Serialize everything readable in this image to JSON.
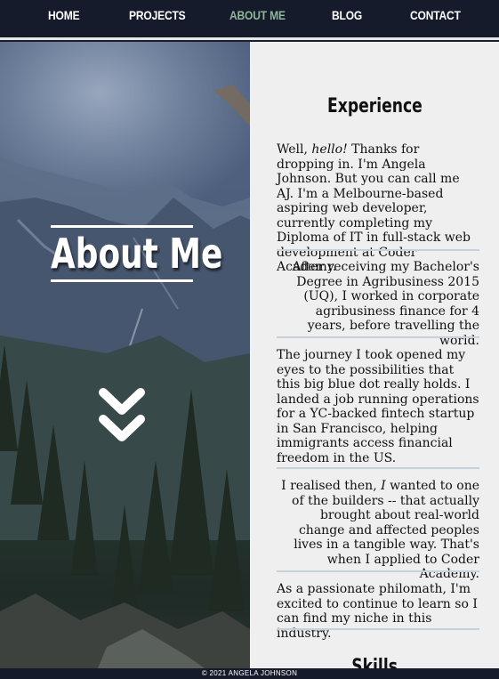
{
  "nav": {
    "items": [
      {
        "label": "HOME",
        "active": false
      },
      {
        "label": "PROJECTS",
        "active": false
      },
      {
        "label": "ABOUT ME",
        "active": true
      },
      {
        "label": "BLOG",
        "active": false
      },
      {
        "label": "CONTACT",
        "active": false
      }
    ],
    "active_color": "#8fb59a"
  },
  "hero": {
    "title": "About Me",
    "scroll_icon": "double-chevron-down-icon"
  },
  "experience": {
    "title": "Experience",
    "p1": {
      "prefix": "Well, ",
      "emphasis": "hello!",
      "rest": " Thanks for dropping in. I'm Angela Johnson. But you can call me AJ. I'm a Melbourne-based aspiring web developer, currently completing my Diploma of IT in full-stack web development at Coder Academy."
    },
    "p2": "After receiving my Bachelor's Degree in Agribusiness 2015 (UQ), I worked in corporate agribusiness finance for 4 years, before travelling the world.",
    "p3": "The journey I took opened my eyes to the possibilities that this big blue dot really holds. I landed a job running operations for a YC-backed fintech startup in San Francisco, helping immigrants access financial freedom in the US.",
    "p4": {
      "prefix": "I realised then, ",
      "emphasis": "I",
      "rest": " wanted to one of the builders -- that actually brought about real-world change and affected peoples lives in a tangible way. That's when I applied to Coder Academy."
    },
    "p5": "As a passionate philomath, I'm excited to continue to learn so I can find my niche in this industry."
  },
  "skills": {
    "title": "Skills"
  },
  "footer": {
    "text": "© 2021 ANGELA JOHNSON"
  }
}
